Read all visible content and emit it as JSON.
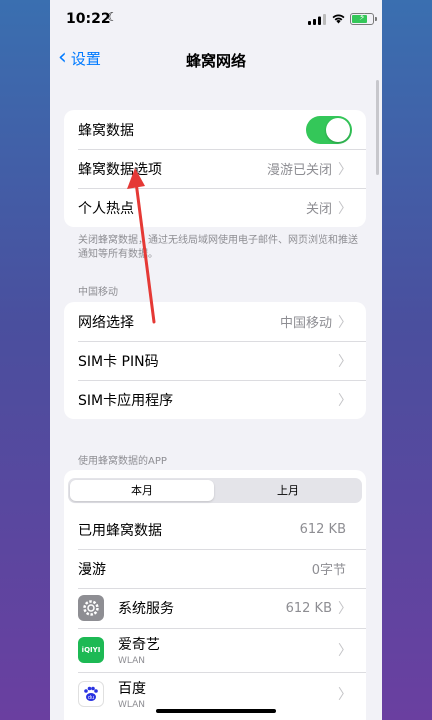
{
  "status_bar": {
    "time": "10:22"
  },
  "nav": {
    "back_label": "设置",
    "title": "蜂窝网络"
  },
  "cellular": {
    "cellular_data_label": "蜂窝数据",
    "cellular_data_on": true,
    "options_label": "蜂窝数据选项",
    "options_value": "漫游已关闭",
    "hotspot_label": "个人热点",
    "hotspot_value": "关闭"
  },
  "footnote": "关闭蜂窝数据，通过无线局域网使用电子邮件、网页浏览和推送通知等所有数据。",
  "carrier": {
    "header": "中国移动",
    "network_label": "网络选择",
    "network_value": "中国移动",
    "sim_pin_label": "SIM卡 PIN码",
    "sim_apps_label": "SIM卡应用程序"
  },
  "apps": {
    "header": "使用蜂窝数据的APP",
    "segments": [
      "本月",
      "上月"
    ],
    "rows": [
      {
        "label": "已用蜂窝数据",
        "value": "612 KB"
      },
      {
        "label": "漫游",
        "value": "0字节"
      }
    ],
    "system_services": {
      "label": "系统服务",
      "value": "612 KB"
    },
    "iqiyi": {
      "name": "爱奇艺",
      "sub": "WLAN",
      "icon_text": "iQIYI"
    },
    "baidu": {
      "name": "百度",
      "sub": "WLAN",
      "icon_text": "du"
    }
  },
  "colors": {
    "accent": "#007aff",
    "toggle_on": "#34c759",
    "annotation_arrow": "#e53935"
  }
}
